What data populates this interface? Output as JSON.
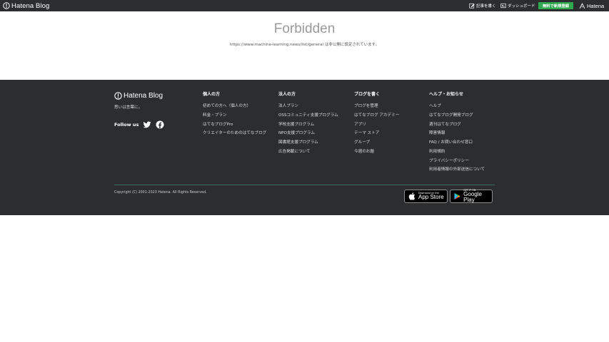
{
  "topbar": {
    "logo_text": "Hatena Blog",
    "write_label": "記事を書く",
    "dashboard_label": "ダッシュボード",
    "signup_label": "無料で新規登録",
    "hatena_label": "Hatena"
  },
  "main": {
    "title": "Forbidden",
    "message": "https://www.machine-learning.news/list/general は非公開に設定されています。"
  },
  "footer": {
    "logo_text": "Hatena Blog",
    "tagline": "思いは言葉に。",
    "follow_label": "Follow us",
    "columns": [
      {
        "heading": "個人の方",
        "items": [
          "初めての方へ（個人の方）",
          "料金・プラン",
          "はてなブログPro",
          "クリエイターのためのはてなブログ"
        ]
      },
      {
        "heading": "法人の方",
        "items": [
          "法人プラン",
          "OSSコミュニティ支援プログラム",
          "学校支援プログラム",
          "NPO支援プログラム",
          "図書館支援プログラム",
          "広告掲載について"
        ]
      },
      {
        "heading": "ブログを書く",
        "items": [
          "ブログを管理",
          "はてなブログ アカデミー",
          "アプリ",
          "テーマ ストア",
          "グループ",
          "今週のお題"
        ]
      },
      {
        "heading": "ヘルプ・お知らせ",
        "items": [
          "ヘルプ",
          "はてなブログ開発ブログ",
          "週刊はてなブログ",
          "障害情報",
          "FAQ / お問い合わせ窓口",
          "利用規約",
          "プライバシーポリシー",
          "利用者情報の外部送信について"
        ]
      }
    ],
    "copyright": "Copyright (C) 2001-2023 Hatena. All Rights Reserved.",
    "app_store": {
      "small": "Download on the",
      "big": "App Store"
    },
    "google_play": {
      "small": "GET IT ON",
      "big": "Google Play"
    }
  },
  "colors": {
    "topbar_bg": "#2c2d2f",
    "footer_bg": "#2c2d2f",
    "signup_bg": "#2fa84f",
    "title_color": "#9a9a9a",
    "divider": "#3d6b63"
  },
  "icons": [
    "hatena-blog-logo-icon",
    "pencil-icon",
    "dashboard-icon",
    "hatena-logo-icon",
    "twitter-icon",
    "facebook-icon",
    "apple-icon",
    "google-play-icon"
  ]
}
